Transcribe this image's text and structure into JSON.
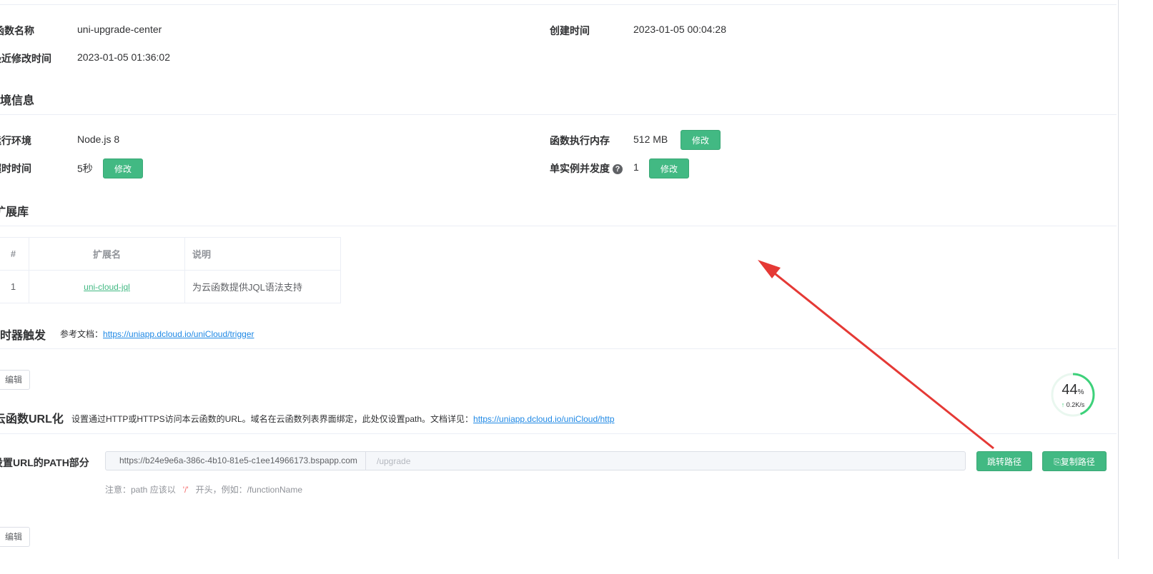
{
  "basic": {
    "func_name_label": "函数名称",
    "func_name": "uni-upgrade-center",
    "created_label": "创建时间",
    "created": "2023-01-05 00:04:28",
    "modified_label": "最近修改时间",
    "modified": "2023-01-05 01:36:02"
  },
  "env": {
    "title": "环境信息",
    "runtime_label": "运行环境",
    "runtime": "Node.js 8",
    "memory_label": "函数执行内存",
    "memory": "512 MB",
    "timeout_label": "超时时间",
    "timeout": "5秒",
    "concurrency_label": "单实例并发度",
    "concurrency": "1",
    "edit_label": "修改"
  },
  "extensions": {
    "title": "扩展库",
    "columns": [
      "#",
      "扩展名",
      "说明"
    ],
    "rows": [
      {
        "index": "1",
        "name": "uni-cloud-jql",
        "desc": "为云函数提供JQL语法支持"
      }
    ]
  },
  "trigger": {
    "title": "定时器触发",
    "doc_label": "参考文档：",
    "doc_url": "https://uniapp.dcloud.io/uniCloud/trigger",
    "edit_label": "编辑"
  },
  "url_section": {
    "title": "云函数URL化",
    "desc": "设置通过HTTP或HTTPS访问本云函数的URL。域名在云函数列表界面绑定，此处仅设置path。文档详见：",
    "doc_url": "https://uniapp.dcloud.io/uniCloud/http",
    "path_label": "设置URL的PATH部分",
    "domain_prefix": "https://b24e9e6a-386c-4b10-81e5-c1ee14966173.bspapp.com",
    "path_placeholder": "/upgrade",
    "goto_label": "跳转路径",
    "copy_label": "复制路径",
    "hint_prefix": "注意：path 应该以",
    "hint_slash": "'/'",
    "hint_suffix": "开头，例如：/functionName",
    "edit_label": "编辑"
  },
  "monitor": {
    "percent": "44",
    "percent_unit": "%",
    "speed": "0.2K/s",
    "level": 0.44
  },
  "colors": {
    "accent": "#42b983",
    "link": "#1e88e5",
    "arrow": "#e53935"
  }
}
